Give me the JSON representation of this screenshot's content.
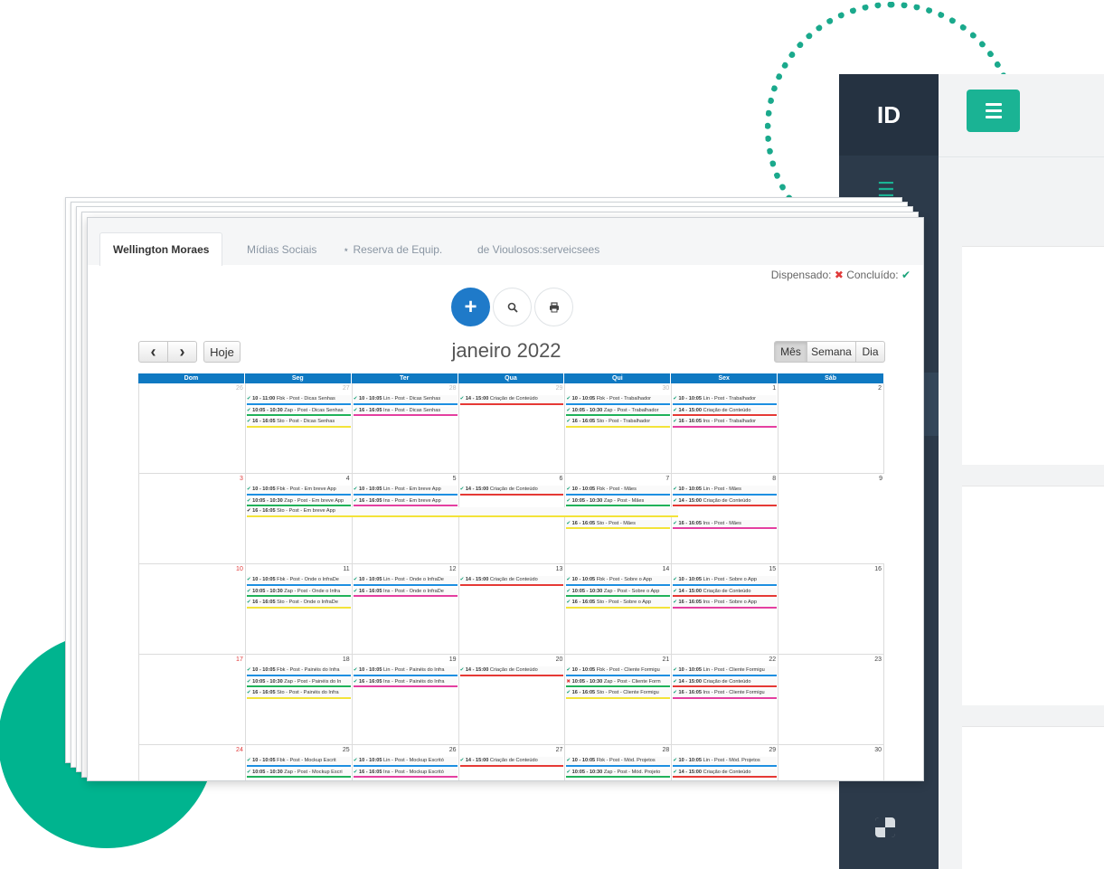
{
  "brand": "ID",
  "tabs": [
    {
      "label": "Wellington Moraes",
      "active": true
    },
    {
      "label": "Mídias Sociais",
      "active": false
    },
    {
      "label": "Reserva de Equip.",
      "active": false,
      "icon": "sitemap-icon"
    },
    {
      "label": "de Vioulosos:serveicsees",
      "active": false
    }
  ],
  "legend": {
    "dismissed_label": "Dispensado:",
    "dismissed_symbol": "✖",
    "done_label": "Concluído:",
    "done_symbol": "✔"
  },
  "toolbar": {
    "add_symbol": "+",
    "search_icon": "search-icon",
    "print_icon": "print-icon"
  },
  "nav": {
    "prev": "‹",
    "next": "›",
    "today": "Hoje"
  },
  "month_title": "janeiro 2022",
  "views": [
    {
      "label": "Mês",
      "active": true
    },
    {
      "label": "Semana",
      "active": false
    },
    {
      "label": "Dia",
      "active": false
    }
  ],
  "weekdays": [
    "Dom",
    "Seg",
    "Ter",
    "Qua",
    "Qui",
    "Sex",
    "Sáb"
  ],
  "colors": {
    "blue": "#1d8fe1",
    "green": "#20b25a",
    "yellow": "#f3e339",
    "red": "#e53935",
    "pink": "#e43fa0",
    "accent": "#1ab394",
    "header": "#0f79c2"
  },
  "weeks": [
    {
      "days": [
        {
          "num": "26",
          "other": true,
          "sun": false,
          "events": []
        },
        {
          "num": "27",
          "other": true,
          "events": [
            {
              "time": "10 - 11:00",
              "text": "Fbk - Post - Dicas Senhas",
              "color": "blue",
              "status": "ok"
            },
            {
              "time": "10:05 - 10:30",
              "text": "Zap - Post - Dicas Senhas",
              "color": "green",
              "status": "ok"
            },
            {
              "time": "16 - 16:05",
              "text": "Sto - Post - Dicas Senhas",
              "color": "yellow",
              "status": "ok"
            }
          ]
        },
        {
          "num": "28",
          "other": true,
          "events": [
            {
              "time": "10 - 10:05",
              "text": "Lin - Post - Dicas Senhas",
              "color": "blue",
              "status": "ok"
            },
            {
              "time": "16 - 16:05",
              "text": "Ins - Post - Dicas Senhas",
              "color": "pink",
              "status": "ok"
            }
          ]
        },
        {
          "num": "29",
          "other": true,
          "events": [
            {
              "time": "14 - 15:00",
              "text": "Criação de Conteúdo",
              "color": "red",
              "status": "ok"
            }
          ]
        },
        {
          "num": "30",
          "other": true,
          "events": [
            {
              "time": "10 - 10:05",
              "text": "Fbk - Post - Trabalhador",
              "color": "blue",
              "status": "ok"
            },
            {
              "time": "10:05 - 10:30",
              "text": "Zap - Post - Trabalhador",
              "color": "green",
              "status": "ok"
            },
            {
              "time": "16 - 16:05",
              "text": "Sto - Post - Trabalhador",
              "color": "yellow",
              "status": "ok"
            }
          ]
        },
        {
          "num": "1",
          "other": false,
          "events": [
            {
              "time": "10 - 10:05",
              "text": "Lin - Post - Trabalhador",
              "color": "blue",
              "status": "ok"
            },
            {
              "time": "14 - 15:00",
              "text": "Criação de Conteúdo",
              "color": "red",
              "status": "ok"
            },
            {
              "time": "16 - 16:05",
              "text": "Ins - Post - Trabalhador",
              "color": "pink",
              "status": "ok"
            }
          ]
        },
        {
          "num": "2",
          "other": false,
          "events": []
        }
      ]
    },
    {
      "span": {
        "time": "16 - 16:05",
        "text": "Sto - Post - Em breve App",
        "status": "ok"
      },
      "days": [
        {
          "num": "3",
          "sun": true,
          "events": []
        },
        {
          "num": "4",
          "events": [
            {
              "time": "10 - 10:05",
              "text": "Fbk - Post - Em breve App",
              "color": "blue",
              "status": "ok"
            },
            {
              "time": "10:05 - 10:30",
              "text": "Zap - Post - Em breve App",
              "color": "green",
              "status": "ok"
            }
          ]
        },
        {
          "num": "5",
          "events": [
            {
              "time": "10 - 10:05",
              "text": "Lin - Post - Em breve App",
              "color": "blue",
              "status": "ok"
            },
            {
              "time": "16 - 16:05",
              "text": "Ins - Post - Em breve App",
              "color": "pink",
              "status": "ok"
            }
          ]
        },
        {
          "num": "6",
          "events": [
            {
              "time": "14 - 15:00",
              "text": "Criação de Conteúdo",
              "color": "red",
              "status": "ok"
            }
          ]
        },
        {
          "num": "7",
          "events": [
            {
              "time": "10 - 10:05",
              "text": "Fbk - Post - Mães",
              "color": "blue",
              "status": "ok"
            },
            {
              "time": "10:05 - 10:30",
              "text": "Zap - Post - Mães",
              "color": "green",
              "status": "ok"
            },
            {
              "blank": true
            },
            {
              "time": "16 - 16:05",
              "text": "Sto - Post - Mães",
              "color": "yellow",
              "status": "ok"
            }
          ]
        },
        {
          "num": "8",
          "events": [
            {
              "time": "10 - 10:05",
              "text": "Lin - Post - Mães",
              "color": "blue",
              "status": "ok"
            },
            {
              "time": "14 - 15:00",
              "text": "Criação de Conteúdo",
              "color": "red",
              "status": "ok"
            },
            {
              "blank": true
            },
            {
              "time": "16 - 16:05",
              "text": "Ins - Post - Mães",
              "color": "pink",
              "status": "ok"
            }
          ]
        },
        {
          "num": "9",
          "events": []
        }
      ]
    },
    {
      "days": [
        {
          "num": "10",
          "sun": true,
          "events": []
        },
        {
          "num": "11",
          "events": [
            {
              "time": "10 - 10:05",
              "text": "Fbk - Post - Onde o InfraDe",
              "color": "blue",
              "status": "ok"
            },
            {
              "time": "10:05 - 10:30",
              "text": "Zap - Post - Onde o Infra",
              "color": "green",
              "status": "ok"
            },
            {
              "time": "16 - 16:05",
              "text": "Sto - Post - Onde o InfraDe",
              "color": "yellow",
              "status": "ok"
            }
          ]
        },
        {
          "num": "12",
          "events": [
            {
              "time": "10 - 10:05",
              "text": "Lin - Post - Onde o InfraDe",
              "color": "blue",
              "status": "ok"
            },
            {
              "time": "16 - 16:05",
              "text": "Ins - Post - Onde o InfraDe",
              "color": "pink",
              "status": "ok"
            }
          ]
        },
        {
          "num": "13",
          "events": [
            {
              "time": "14 - 15:00",
              "text": "Criação de Conteúdo",
              "color": "red",
              "status": "ok"
            }
          ]
        },
        {
          "num": "14",
          "events": [
            {
              "time": "10 - 10:05",
              "text": "Fbk - Post - Sobre o App",
              "color": "blue",
              "status": "ok"
            },
            {
              "time": "10:05 - 10:30",
              "text": "Zap - Post - Sobre o App",
              "color": "green",
              "status": "ok"
            },
            {
              "time": "16 - 16:05",
              "text": "Sto - Post - Sobre o App",
              "color": "yellow",
              "status": "ok"
            }
          ]
        },
        {
          "num": "15",
          "events": [
            {
              "time": "10 - 10:05",
              "text": "Lin - Post - Sobre o App",
              "color": "blue",
              "status": "ok"
            },
            {
              "time": "14 - 15:00",
              "text": "Criação de Conteúdo",
              "color": "red",
              "status": "ok"
            },
            {
              "time": "16 - 16:05",
              "text": "Ins - Post - Sobre o App",
              "color": "pink",
              "status": "ok"
            }
          ]
        },
        {
          "num": "16",
          "events": []
        }
      ]
    },
    {
      "days": [
        {
          "num": "17",
          "sun": true,
          "events": []
        },
        {
          "num": "18",
          "events": [
            {
              "time": "10 - 10:05",
              "text": "Fbk - Post - Painéis do Infra",
              "color": "blue",
              "status": "ok"
            },
            {
              "time": "10:05 - 10:30",
              "text": "Zap - Post - Painéis do In",
              "color": "green",
              "status": "ok"
            },
            {
              "time": "16 - 16:05",
              "text": "Sto - Post - Painéis do Infra",
              "color": "yellow",
              "status": "ok"
            }
          ]
        },
        {
          "num": "19",
          "events": [
            {
              "time": "10 - 10:05",
              "text": "Lin - Post - Painéis do Infra",
              "color": "blue",
              "status": "ok"
            },
            {
              "time": "16 - 16:05",
              "text": "Ins - Post - Painéis do Infra",
              "color": "pink",
              "status": "ok"
            }
          ]
        },
        {
          "num": "20",
          "events": [
            {
              "time": "14 - 15:00",
              "text": "Criação de Conteúdo",
              "color": "red",
              "status": "ok"
            }
          ]
        },
        {
          "num": "21",
          "events": [
            {
              "time": "10 - 10:05",
              "text": "Fbk - Post - Cliente Formigu",
              "color": "blue",
              "status": "ok"
            },
            {
              "time": "10:05 - 10:30",
              "text": "Zap - Post - Cliente Form",
              "color": "green",
              "status": "x"
            },
            {
              "time": "16 - 16:05",
              "text": "Sto - Post - Cliente Formigu",
              "color": "yellow",
              "status": "ok"
            }
          ]
        },
        {
          "num": "22",
          "events": [
            {
              "time": "10 - 10:05",
              "text": "Lin - Post - Cliente Formigu",
              "color": "blue",
              "status": "ok"
            },
            {
              "time": "14 - 15:00",
              "text": "Criação de Conteúdo",
              "color": "red",
              "status": "ok"
            },
            {
              "time": "16 - 16:05",
              "text": "Ins - Post - Cliente Formigu",
              "color": "pink",
              "status": "ok"
            }
          ]
        },
        {
          "num": "23",
          "events": []
        }
      ]
    },
    {
      "days": [
        {
          "num": "24",
          "sun": true,
          "events": []
        },
        {
          "num": "25",
          "events": [
            {
              "time": "10 - 10:05",
              "text": "Fbk - Post - Mockup Escrit",
              "color": "blue",
              "status": "ok"
            },
            {
              "time": "10:05 - 10:30",
              "text": "Zap - Post - Mockup Escri",
              "color": "green",
              "status": "ok"
            }
          ]
        },
        {
          "num": "26",
          "events": [
            {
              "time": "10 - 10:05",
              "text": "Lin - Post - Mockup Escritó",
              "color": "blue",
              "status": "ok"
            },
            {
              "time": "16 - 16:05",
              "text": "Ins - Post - Mockup Escritó",
              "color": "pink",
              "status": "ok"
            }
          ]
        },
        {
          "num": "27",
          "events": [
            {
              "time": "14 - 15:00",
              "text": "Criação de Conteúdo",
              "color": "red",
              "status": "ok"
            }
          ]
        },
        {
          "num": "28",
          "events": [
            {
              "time": "10 - 10:05",
              "text": "Fbk - Post - Mód. Projetos",
              "color": "blue",
              "status": "ok"
            },
            {
              "time": "10:05 - 10:30",
              "text": "Zap - Post - Mód. Projeto",
              "color": "green",
              "status": "ok"
            }
          ]
        },
        {
          "num": "29",
          "events": [
            {
              "time": "10 - 10:05",
              "text": "Lin - Post - Mód. Projetos",
              "color": "blue",
              "status": "ok"
            },
            {
              "time": "14 - 15:00",
              "text": "Criação de Conteúdo",
              "color": "red",
              "status": "ok"
            }
          ]
        },
        {
          "num": "30",
          "events": []
        }
      ]
    }
  ]
}
